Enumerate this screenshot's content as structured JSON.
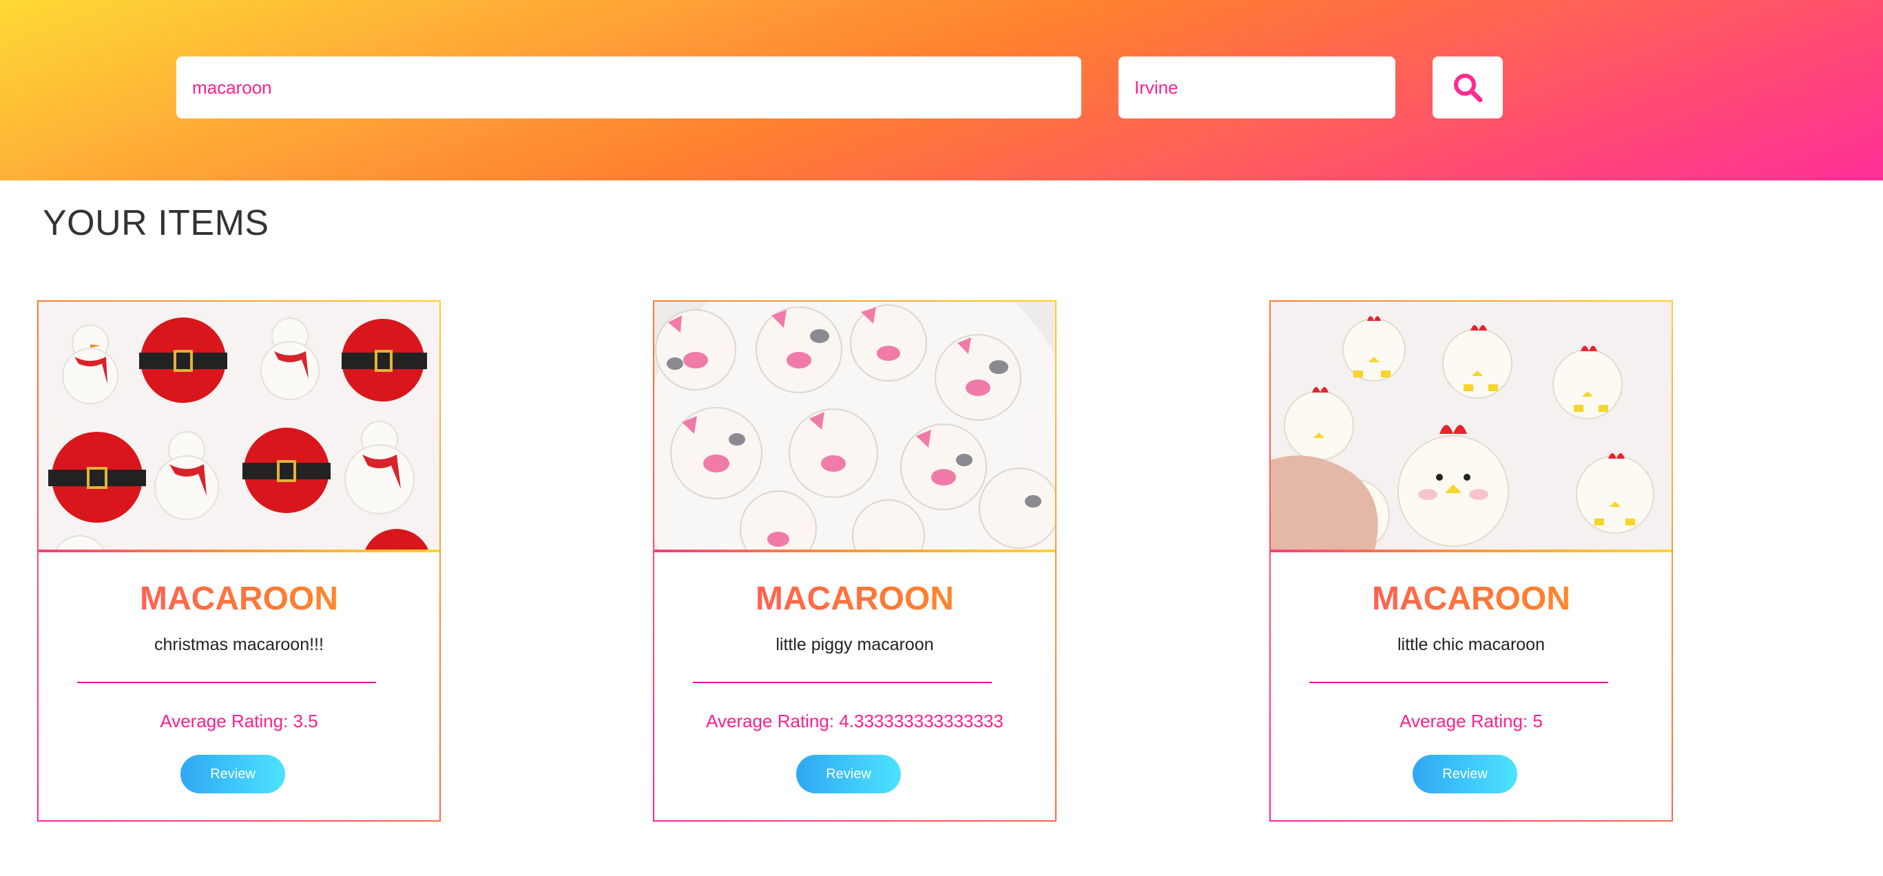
{
  "search": {
    "term_value": "macaroon",
    "location_value": "Irvine",
    "button_icon": "search-icon"
  },
  "section": {
    "title": "YOUR ITEMS"
  },
  "items": [
    {
      "name": "MACAROON",
      "description": "christmas macaroon!!!",
      "rating": "Average Rating: 3.5",
      "review_label": "Review",
      "image": "christmas-macaroons-photo"
    },
    {
      "name": "MACAROON",
      "description": "little piggy macaroon",
      "rating": "Average Rating: 4.333333333333333",
      "review_label": "Review",
      "image": "piggy-macaroons-photo"
    },
    {
      "name": "MACAROON",
      "description": "little chic macaroon",
      "rating": "Average Rating: 5",
      "review_label": "Review",
      "image": "chick-macaroons-photo"
    }
  ],
  "colors": {
    "accent_pink": "#ff1f8e",
    "header_gradient": [
      "#fed935",
      "#ff7e30",
      "#ff2e98"
    ],
    "review_gradient": [
      "#2fa8f3",
      "#4ce3ff"
    ]
  }
}
